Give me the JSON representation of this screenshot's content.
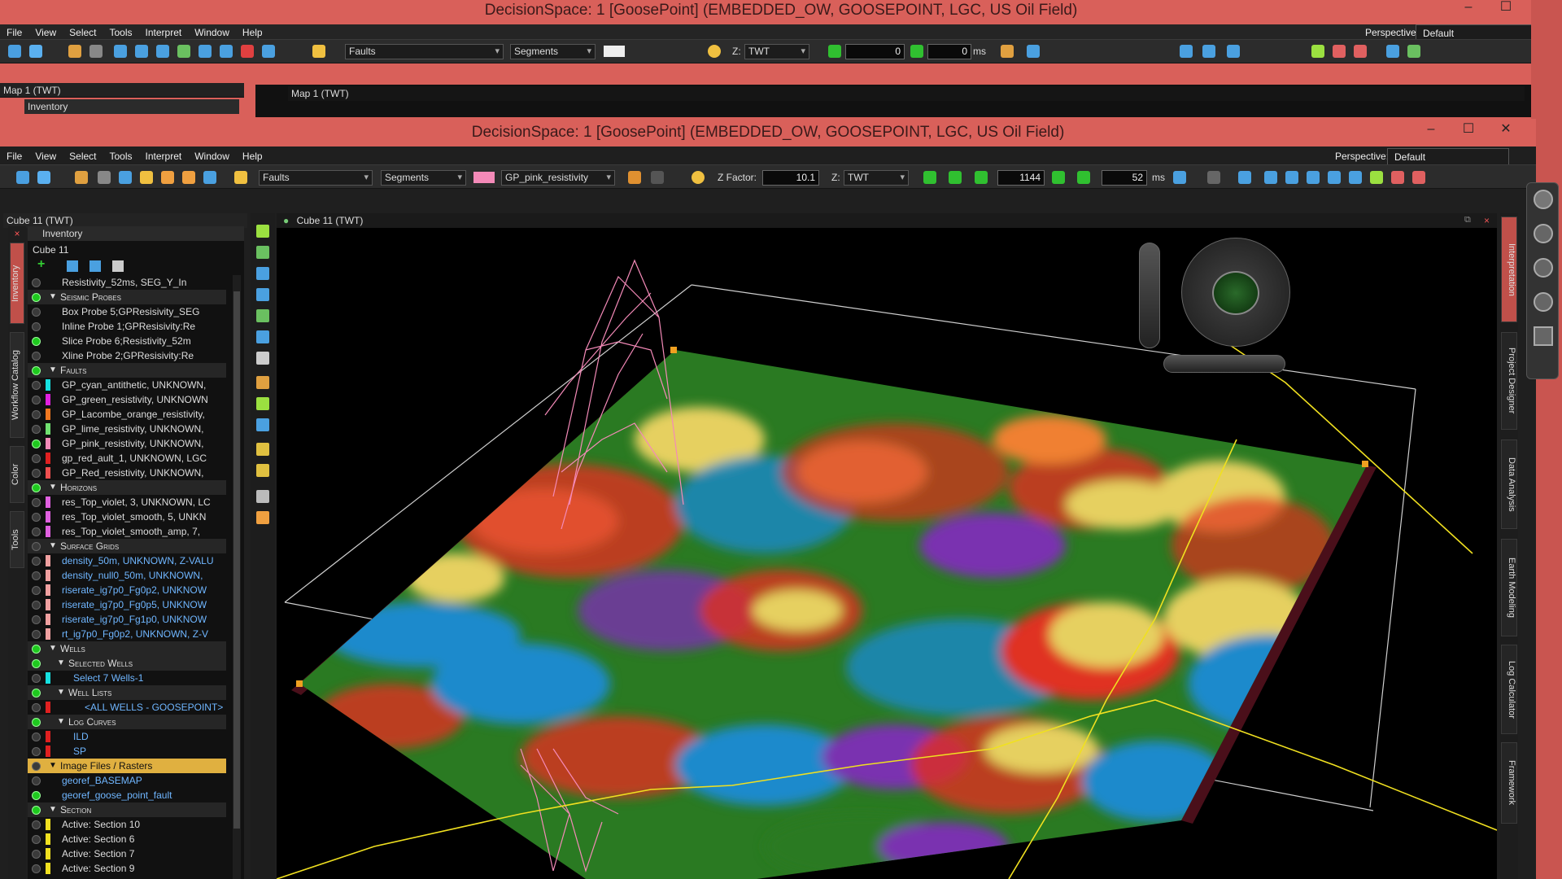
{
  "back_window": {
    "title": "DecisionSpace: 1 [GoosePoint] (EMBEDDED_OW, GOOSEPOINT, LGC, US Oil Field)",
    "menu": [
      "File",
      "View",
      "Select",
      "Tools",
      "Interpret",
      "Window",
      "Help"
    ],
    "perspective_label": "Perspective:",
    "perspective_value": "Default",
    "toolbar": {
      "object_type": "Faults",
      "mode": "Segments",
      "z_domain": "TWT",
      "z_label": "Z:",
      "value1": "0",
      "value2": "0",
      "unit": "ms"
    },
    "panel_title": "Map 1 (TWT)",
    "inventory_label": "Inventory",
    "tab_title": "Map 1 (TWT)"
  },
  "front_window": {
    "title": "DecisionSpace: 1 [GoosePoint] (EMBEDDED_OW, GOOSEPOINT, LGC, US Oil Field)",
    "menu": [
      "File",
      "View",
      "Select",
      "Tools",
      "Interpret",
      "Window",
      "Help"
    ],
    "perspective_label": "Perspective:",
    "perspective_value": "Default",
    "toolbar": {
      "object_type": "Faults",
      "mode": "Segments",
      "fault_name": "GP_pink_resistivity",
      "fault_color": "#f48ab8",
      "zfactor_label": "Z Factor:",
      "zfactor_value": "10.1",
      "z_label": "Z:",
      "z_domain": "TWT",
      "frame": "1144",
      "time": "52",
      "unit": "ms"
    },
    "panel_title": "Cube 11 (TWT)",
    "view_title": "Cube 11 (TWT)"
  },
  "inventory": {
    "header": "Inventory",
    "root": "Cube 11",
    "rows": [
      {
        "text": "Resistivity_52ms, SEG_Y_In",
        "type": "item",
        "indent": 2,
        "dot": false,
        "color": ""
      },
      {
        "text": "Seismic Probes",
        "type": "group",
        "indent": 1,
        "dot": true,
        "color": ""
      },
      {
        "text": "Box Probe 5;GPResisivity_SEG",
        "type": "item",
        "indent": 2,
        "dot": false,
        "color": ""
      },
      {
        "text": "Inline Probe 1;GPResisivity:Re",
        "type": "item",
        "indent": 2,
        "dot": false,
        "color": ""
      },
      {
        "text": "Slice Probe 6;Resistivity_52m",
        "type": "item",
        "indent": 2,
        "dot": true,
        "color": ""
      },
      {
        "text": "Xline Probe 2;GPResisivity:Re",
        "type": "item",
        "indent": 2,
        "dot": false,
        "color": ""
      },
      {
        "text": "Faults",
        "type": "group",
        "indent": 1,
        "dot": true,
        "color": ""
      },
      {
        "text": "GP_cyan_antithetic, UNKNOWN,",
        "type": "item",
        "indent": 2,
        "dot": false,
        "color": "#16e0e0"
      },
      {
        "text": "GP_green_resistivity, UNKNOWN",
        "type": "item",
        "indent": 2,
        "dot": false,
        "color": "#e020e0"
      },
      {
        "text": "GP_Lacombe_orange_resistivity,",
        "type": "item",
        "indent": 2,
        "dot": false,
        "color": "#f07820"
      },
      {
        "text": "GP_lime_resistivity, UNKNOWN,",
        "type": "item",
        "indent": 2,
        "dot": false,
        "color": "#70e070"
      },
      {
        "text": "GP_pink_resistivity, UNKNOWN,",
        "type": "item",
        "indent": 2,
        "dot": true,
        "color": "#f48ab8"
      },
      {
        "text": "gp_red_ault_1, UNKNOWN, LGC",
        "type": "item",
        "indent": 2,
        "dot": false,
        "color": "#e02020"
      },
      {
        "text": "GP_Red_resistivity, UNKNOWN,",
        "type": "item",
        "indent": 2,
        "dot": false,
        "color": "#f05050"
      },
      {
        "text": "Horizons",
        "type": "group",
        "indent": 1,
        "dot": true,
        "color": ""
      },
      {
        "text": "res_Top_violet, 3, UNKNOWN, LC",
        "type": "item",
        "indent": 2,
        "dot": false,
        "color": "#e060e0"
      },
      {
        "text": "res_Top_violet_smooth, 5, UNKN",
        "type": "item",
        "indent": 2,
        "dot": false,
        "color": "#e060e0"
      },
      {
        "text": "res_Top_violet_smooth_amp, 7,",
        "type": "item",
        "indent": 2,
        "dot": false,
        "color": "#e060e0"
      },
      {
        "text": "Surface Grids",
        "type": "group",
        "indent": 1,
        "dot": false,
        "color": ""
      },
      {
        "text": "density_50m, UNKNOWN, Z-VALU",
        "type": "link",
        "indent": 2,
        "dot": false,
        "color": "#f0a0a0"
      },
      {
        "text": "density_null0_50m, UNKNOWN,",
        "type": "link",
        "indent": 2,
        "dot": false,
        "color": "#f0a0a0"
      },
      {
        "text": "riserate_ig7p0_Fg0p2, UNKNOW",
        "type": "link",
        "indent": 2,
        "dot": false,
        "color": "#f0a0a0"
      },
      {
        "text": "riserate_ig7p0_Fg0p5, UNKNOW",
        "type": "link",
        "indent": 2,
        "dot": false,
        "color": "#f0a0a0"
      },
      {
        "text": "riserate_ig7p0_Fg1p0, UNKNOW",
        "type": "link",
        "indent": 2,
        "dot": false,
        "color": "#f0a0a0"
      },
      {
        "text": "rt_ig7p0_Fg0p2, UNKNOWN, Z-V",
        "type": "link",
        "indent": 2,
        "dot": false,
        "color": "#f0a0a0"
      },
      {
        "text": "Wells",
        "type": "group",
        "indent": 1,
        "dot": true,
        "color": ""
      },
      {
        "text": "Selected Wells",
        "type": "group",
        "indent": 2,
        "dot": true,
        "color": ""
      },
      {
        "text": "Select 7 Wells-1",
        "type": "link",
        "indent": 3,
        "dot": false,
        "color": "#16e0e0"
      },
      {
        "text": "Well Lists",
        "type": "group",
        "indent": 2,
        "dot": true,
        "color": ""
      },
      {
        "text": "<ALL WELLS - GOOSEPOINT>",
        "type": "link",
        "indent": 4,
        "dot": false,
        "color": "#e02020"
      },
      {
        "text": "Log Curves",
        "type": "group",
        "indent": 2,
        "dot": true,
        "color": ""
      },
      {
        "text": "ILD",
        "type": "link",
        "indent": 3,
        "dot": false,
        "color": "#e02020"
      },
      {
        "text": "SP",
        "type": "link",
        "indent": 3,
        "dot": false,
        "color": "#e02020"
      },
      {
        "text": "Image Files / Rasters",
        "type": "highlight",
        "indent": 1,
        "dot": false,
        "color": ""
      },
      {
        "text": "georef_BASEMAP",
        "type": "link",
        "indent": 2,
        "dot": false,
        "color": ""
      },
      {
        "text": "georef_goose_point_fault",
        "type": "link",
        "indent": 2,
        "dot": true,
        "color": ""
      },
      {
        "text": "Section",
        "type": "group",
        "indent": 1,
        "dot": true,
        "color": ""
      },
      {
        "text": "Active: Section 10",
        "type": "item",
        "indent": 2,
        "dot": false,
        "color": "#f0e020"
      },
      {
        "text": "Active: Section 6",
        "type": "item",
        "indent": 2,
        "dot": false,
        "color": "#f0e020"
      },
      {
        "text": "Active: Section 7",
        "type": "item",
        "indent": 2,
        "dot": false,
        "color": "#f0e020"
      },
      {
        "text": "Active: Section 9",
        "type": "item",
        "indent": 2,
        "dot": false,
        "color": "#f0e020"
      }
    ]
  },
  "left_tabs": [
    "Inventory",
    "Workflow Catalog",
    "Color",
    "Tools"
  ],
  "right_tabs": [
    "Interpretation",
    "Project Designer",
    "Data Analysis",
    "Earth Modeling",
    "Log Calculator",
    "Framework"
  ]
}
